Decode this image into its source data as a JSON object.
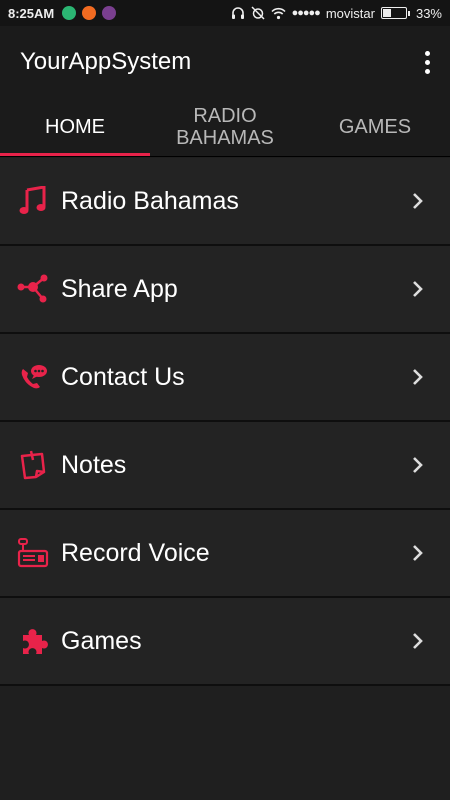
{
  "status_bar": {
    "time": "8:25AM",
    "carrier": "movistar",
    "battery_text": "33%",
    "battery_level": 0.33,
    "signal_dots": "●●●●●"
  },
  "app_bar": {
    "title": "YourAppSystem"
  },
  "tabs": [
    {
      "label": "HOME",
      "active": true
    },
    {
      "label": "RADIO BAHAMAS",
      "active": false
    },
    {
      "label": "GAMES",
      "active": false
    }
  ],
  "menu": [
    {
      "label": "Radio Bahamas",
      "icon": "music-note-icon"
    },
    {
      "label": "Share App",
      "icon": "share-icon"
    },
    {
      "label": "Contact Us",
      "icon": "phone-chat-icon"
    },
    {
      "label": "Notes",
      "icon": "notes-icon"
    },
    {
      "label": "Record Voice",
      "icon": "recorder-icon"
    },
    {
      "label": "Games",
      "icon": "puzzle-icon"
    }
  ],
  "colors": {
    "accent": "#e8234a",
    "background": "#1f1f1f",
    "list_item": "#232323"
  }
}
